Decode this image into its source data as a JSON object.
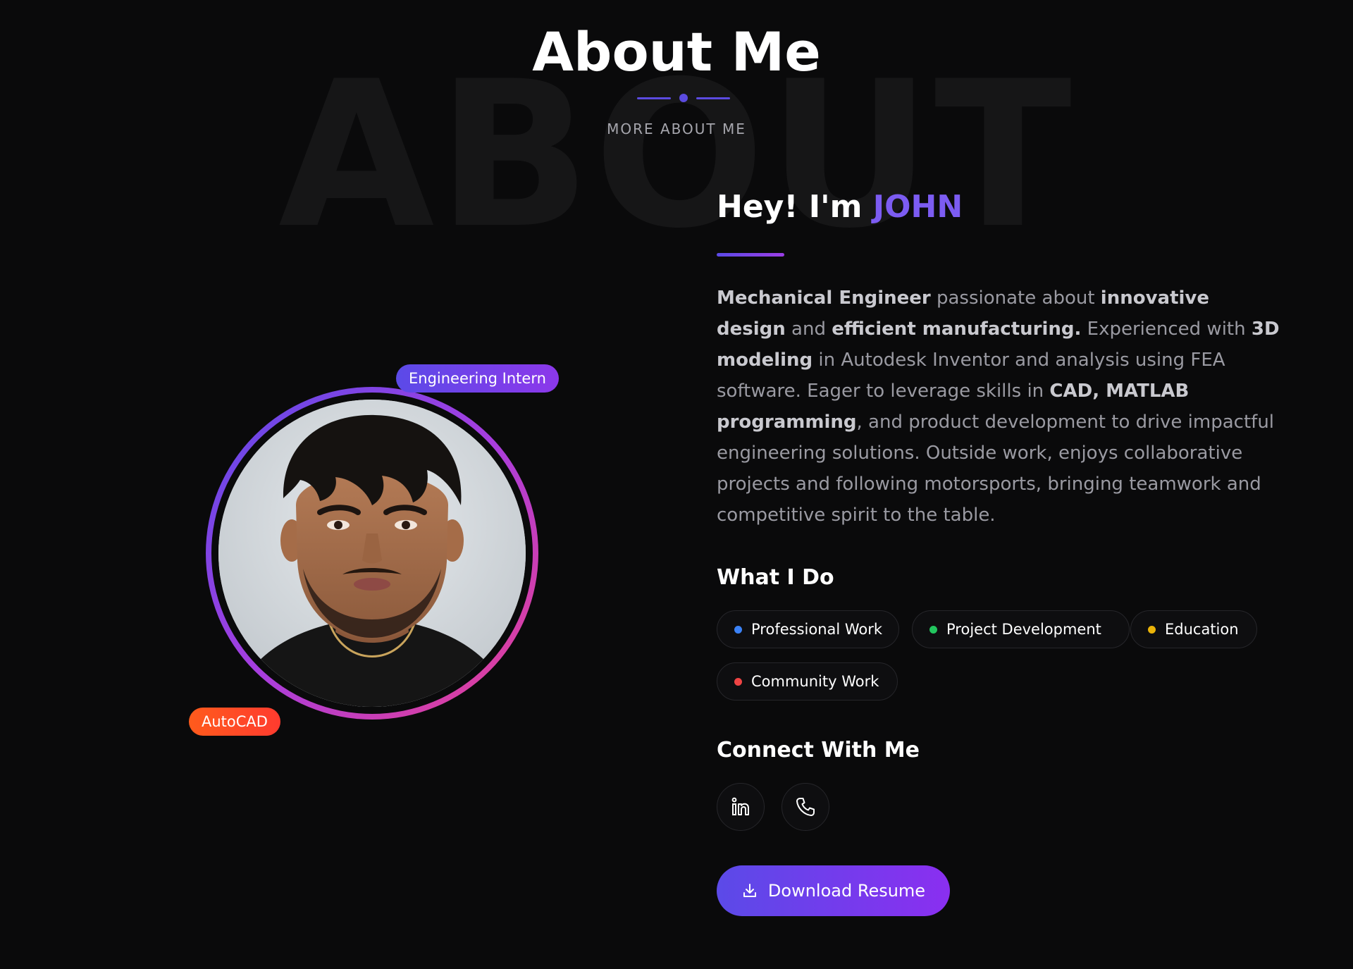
{
  "header": {
    "watermark": "ABOUT",
    "title": "About Me",
    "subtitle": "MORE ABOUT ME"
  },
  "profile": {
    "badges": {
      "top": "Engineering Intern",
      "bottom": "AutoCAD"
    },
    "photo_icon": "person-portrait-photo"
  },
  "intro": {
    "greeting": "Hey! I'm",
    "name": "JOHN",
    "bio": [
      {
        "text": "Mechanical Engineer",
        "bold": true
      },
      {
        "text": " passionate about ",
        "bold": false
      },
      {
        "text": "innovative design",
        "bold": true
      },
      {
        "text": " and ",
        "bold": false
      },
      {
        "text": "efficient manufacturing.",
        "bold": true
      },
      {
        "text": " Experienced with ",
        "bold": false
      },
      {
        "text": "3D modeling",
        "bold": true
      },
      {
        "text": " in Autodesk Inventor and analysis using FEA software. Eager to leverage skills in ",
        "bold": false
      },
      {
        "text": "CAD, MATLAB programming",
        "bold": true
      },
      {
        "text": ", and product development to drive impactful engineering solutions. Outside work, enjoys collaborative projects and following motorsports, bringing teamwork and competitive spirit to the table.",
        "bold": false
      }
    ]
  },
  "what_i_do": {
    "heading": "What I Do",
    "items": [
      {
        "label": "Professional Work",
        "color": "#3b82f6"
      },
      {
        "label": "Project Development",
        "color": "#22c55e"
      },
      {
        "label": "Education",
        "color": "#eab308"
      },
      {
        "label": "Community Work",
        "color": "#ef4444"
      }
    ]
  },
  "connect": {
    "heading": "Connect With Me",
    "links": [
      {
        "icon": "linkedin-icon"
      },
      {
        "icon": "phone-icon"
      }
    ]
  },
  "download": {
    "label": "Download Resume",
    "icon": "download-icon"
  },
  "colors": {
    "accent": "#7c5cf2",
    "background": "#0a0a0b"
  }
}
